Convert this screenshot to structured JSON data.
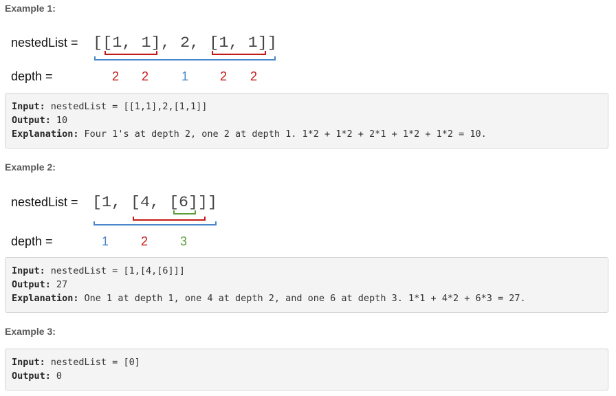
{
  "colors": {
    "red": "#c41a16",
    "blue": "#4a86c8",
    "green": "#5a9e3a"
  },
  "example1": {
    "heading": "Example 1:",
    "figure": {
      "list_label": "nestedList =",
      "list_text": "[[1, 1], 2, [1, 1]]",
      "depth_label": "depth =",
      "depths": [
        "2",
        "2",
        "1",
        "2",
        "2"
      ]
    },
    "input_label": "Input:",
    "input_value": "nestedList = [[1,1],2,[1,1]]",
    "output_label": "Output:",
    "output_value": "10",
    "explanation_label": "Explanation:",
    "explanation_value": "Four 1's at depth 2, one 2 at depth 1. 1*2 + 1*2 + 2*1 + 1*2 + 1*2 = 10."
  },
  "example2": {
    "heading": "Example 2:",
    "figure": {
      "list_label": "nestedList =",
      "list_text": "[1, [4, [6]]]",
      "depth_label": "depth =",
      "depths": [
        "1",
        "2",
        "3"
      ]
    },
    "input_label": "Input:",
    "input_value": "nestedList = [1,[4,[6]]]",
    "output_label": "Output:",
    "output_value": "27",
    "explanation_label": "Explanation:",
    "explanation_value": "One 1 at depth 1, one 4 at depth 2, and one 6 at depth 3. 1*1 + 4*2 + 6*3 = 27."
  },
  "example3": {
    "heading": "Example 3:",
    "input_label": "Input:",
    "input_value": "nestedList = [0]",
    "output_label": "Output:",
    "output_value": "0"
  }
}
